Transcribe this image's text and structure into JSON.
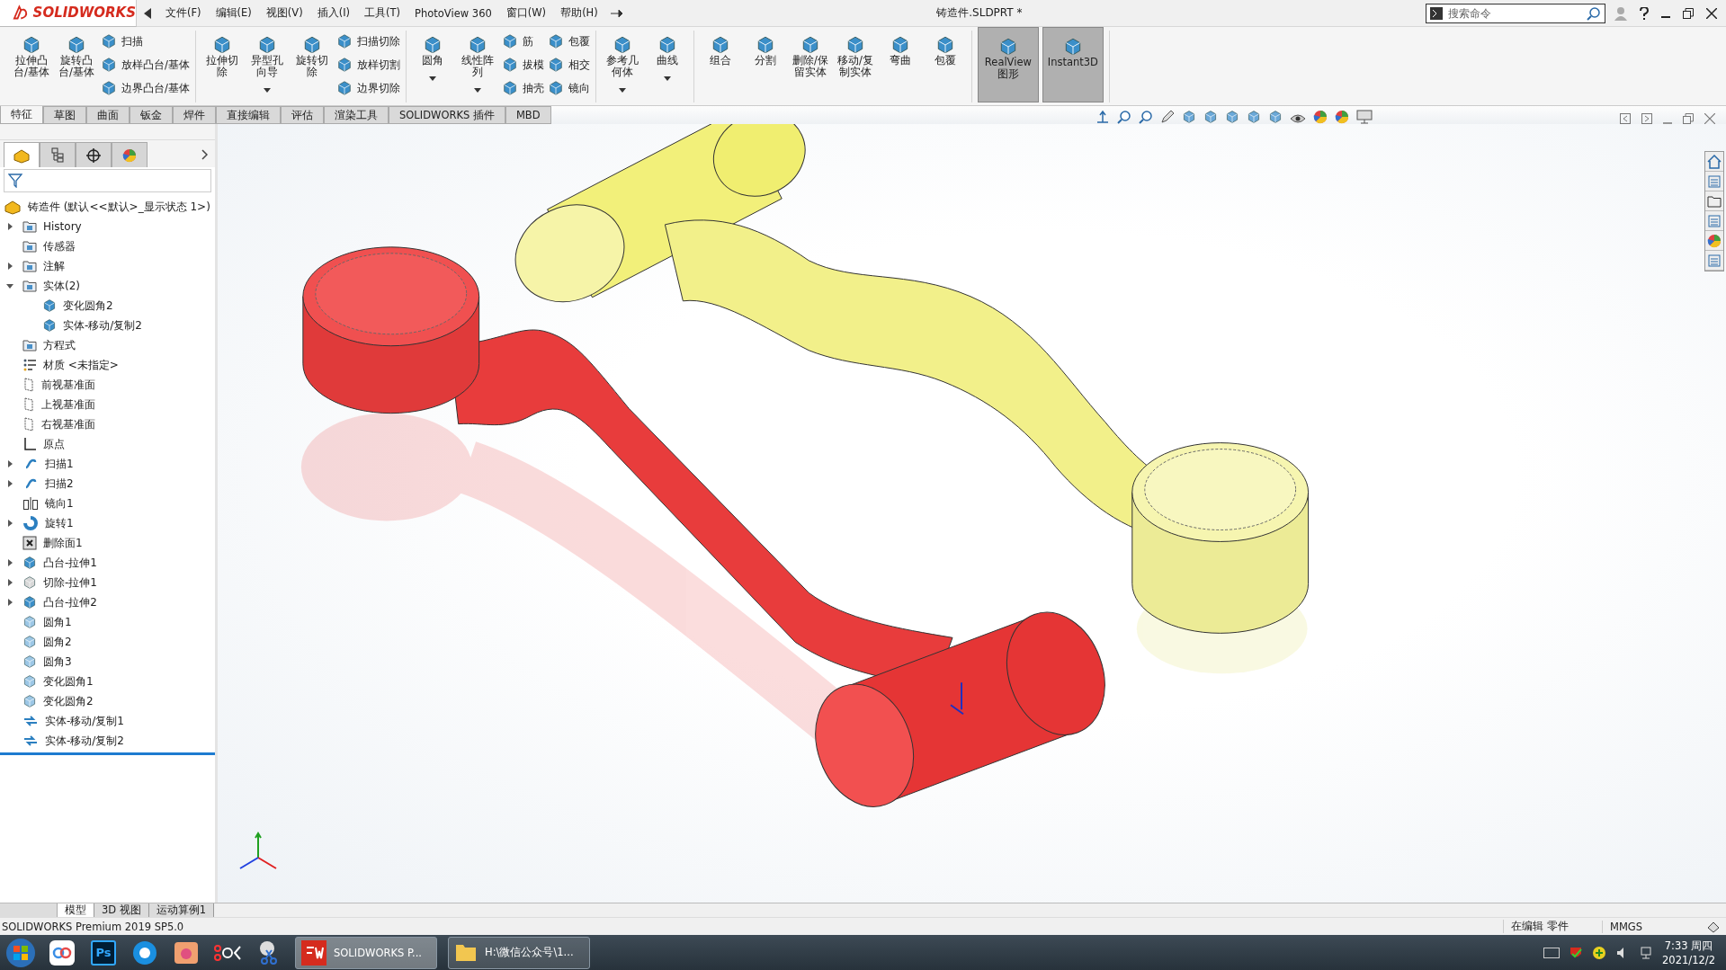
{
  "title_bar": {
    "logo": "SOLIDWORKS",
    "menu": [
      "文件(F)",
      "编辑(E)",
      "视图(V)",
      "插入(I)",
      "工具(T)",
      "PhotoView 360",
      "窗口(W)",
      "帮助(H)"
    ],
    "document_title": "铸造件.SLDPRT *",
    "search": {
      "placeholder": "搜索命令"
    }
  },
  "command_manager": {
    "groups": [
      {
        "buttons": [
          {
            "kind": "large",
            "label": "拉伸凸台/基体",
            "dropdown": false,
            "pressed": false
          },
          {
            "kind": "large",
            "label": "旋转凸台/基体",
            "dropdown": false,
            "pressed": false
          },
          {
            "kind": "stack",
            "items": [
              "扫描",
              "放样凸台/基体",
              "边界凸台/基体"
            ]
          }
        ]
      },
      {
        "buttons": [
          {
            "kind": "large",
            "label": "拉伸切除",
            "dropdown": false,
            "pressed": false
          },
          {
            "kind": "large",
            "label": "异型孔向导",
            "dropdown": true,
            "pressed": false
          },
          {
            "kind": "large",
            "label": "旋转切除",
            "dropdown": false,
            "pressed": false
          },
          {
            "kind": "stack",
            "items": [
              "扫描切除",
              "放样切割",
              "边界切除"
            ]
          }
        ]
      },
      {
        "buttons": [
          {
            "kind": "large",
            "label": "圆角",
            "dropdown": true,
            "pressed": false
          },
          {
            "kind": "large",
            "label": "线性阵列",
            "dropdown": true,
            "pressed": false
          },
          {
            "kind": "stack",
            "items": [
              "筋",
              "拔模",
              "抽壳"
            ]
          },
          {
            "kind": "stack",
            "items": [
              "包覆",
              "相交",
              "镜向"
            ]
          }
        ]
      },
      {
        "buttons": [
          {
            "kind": "large",
            "label": "参考几何体",
            "dropdown": true,
            "pressed": false
          },
          {
            "kind": "large",
            "label": "曲线",
            "dropdown": true,
            "pressed": false
          }
        ]
      },
      {
        "buttons": [
          {
            "kind": "large",
            "label": "组合",
            "dropdown": false,
            "pressed": false
          },
          {
            "kind": "large",
            "label": "分割",
            "dropdown": false,
            "pressed": false
          },
          {
            "kind": "large",
            "label": "删除/保留实体",
            "dropdown": false,
            "pressed": false
          },
          {
            "kind": "large",
            "label": "移动/复制实体",
            "dropdown": false,
            "pressed": false
          },
          {
            "kind": "large",
            "label": "弯曲",
            "dropdown": false,
            "pressed": false
          },
          {
            "kind": "large",
            "label": "包覆",
            "dropdown": false,
            "pressed": false
          }
        ]
      },
      {
        "buttons": [
          {
            "kind": "large",
            "label": "RealView 图形",
            "dropdown": false,
            "pressed": true
          },
          {
            "kind": "large",
            "label": "Instant3D",
            "dropdown": false,
            "pressed": true
          }
        ]
      }
    ]
  },
  "tabs": [
    {
      "label": "特征",
      "selected": true
    },
    {
      "label": "草图",
      "selected": false
    },
    {
      "label": "曲面",
      "selected": false
    },
    {
      "label": "钣金",
      "selected": false
    },
    {
      "label": "焊件",
      "selected": false
    },
    {
      "label": "直接编辑",
      "selected": false
    },
    {
      "label": "评估",
      "selected": false
    },
    {
      "label": "渲染工具",
      "selected": false
    },
    {
      "label": "SOLIDWORKS 插件",
      "selected": false
    },
    {
      "label": "MBD",
      "selected": false
    }
  ],
  "panel_tabs": [
    {
      "selected": true
    },
    {
      "selected": false
    },
    {
      "selected": false
    },
    {
      "selected": false
    }
  ],
  "feature_tree": {
    "root": "铸造件  (默认<<默认>_显示状态 1>)",
    "items": [
      {
        "label": "History",
        "kind": "folder",
        "expanded": false
      },
      {
        "label": "传感器",
        "kind": "folder"
      },
      {
        "label": "注解",
        "kind": "folder",
        "expanded": false
      },
      {
        "label": "实体(2)",
        "kind": "folder",
        "expanded": true,
        "children": [
          {
            "label": "变化圆角2",
            "kind": "body"
          },
          {
            "label": "实体-移动/复制2",
            "kind": "body"
          }
        ]
      },
      {
        "label": "方程式",
        "kind": "folder"
      },
      {
        "label": "材质 <未指定>",
        "kind": "material"
      },
      {
        "label": "前视基准面",
        "kind": "plane"
      },
      {
        "label": "上视基准面",
        "kind": "plane"
      },
      {
        "label": "右视基准面",
        "kind": "plane"
      },
      {
        "label": "原点",
        "kind": "origin"
      },
      {
        "label": "扫描1",
        "kind": "sweep",
        "expanded": false
      },
      {
        "label": "扫描2",
        "kind": "sweep",
        "expanded": false
      },
      {
        "label": "镜向1",
        "kind": "mirror"
      },
      {
        "label": "旋转1",
        "kind": "revolve",
        "expanded": false
      },
      {
        "label": "删除面1",
        "kind": "delete"
      },
      {
        "label": "凸台-拉伸1",
        "kind": "body",
        "expanded": false
      },
      {
        "label": "切除-拉伸1",
        "kind": "cut",
        "expanded": false
      },
      {
        "label": "凸台-拉伸2",
        "kind": "body",
        "expanded": false
      },
      {
        "label": "圆角1",
        "kind": "fillet"
      },
      {
        "label": "圆角2",
        "kind": "fillet"
      },
      {
        "label": "圆角3",
        "kind": "fillet"
      },
      {
        "label": "变化圆角1",
        "kind": "fillet"
      },
      {
        "label": "变化圆角2",
        "kind": "fillet"
      },
      {
        "label": "实体-移动/复制1",
        "kind": "move"
      },
      {
        "label": "实体-移动/复制2",
        "kind": "move"
      }
    ]
  },
  "bottom_tabs": [
    {
      "label": "模型",
      "selected": true
    },
    {
      "label": "3D 视图",
      "selected": false
    },
    {
      "label": "运动算例1",
      "selected": false
    }
  ],
  "status_bar": {
    "product": "SOLIDWORKS Premium 2019 SP5.0",
    "mode": "在编辑 零件",
    "units": "MMGS"
  },
  "taskbar": {
    "apps": [
      {
        "kind": "cloud"
      },
      {
        "kind": "ps",
        "label": "Ps"
      },
      {
        "kind": "aperture"
      },
      {
        "kind": "album"
      },
      {
        "kind": "recorder"
      },
      {
        "kind": "snip"
      },
      {
        "kind": "cad-window",
        "label": "SOLIDWORKS P...",
        "active": true
      },
      {
        "kind": "folder-window",
        "label": "H:\\微信公众号\\1...",
        "active": false
      }
    ],
    "time": "7:33 周四",
    "date": "2021/12/2"
  }
}
